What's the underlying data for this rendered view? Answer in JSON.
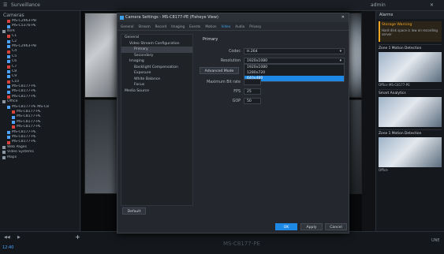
{
  "topbar": {
    "app_menu": "Surveillance",
    "status_right": "admin"
  },
  "tree": {
    "header": "Cameras",
    "items": [
      {
        "label": "MS-C2963-PB",
        "level": 1,
        "kind": "cam"
      },
      {
        "label": "MS-C5376-PE",
        "level": 1,
        "kind": "cam"
      },
      {
        "label": "NVR",
        "level": 0,
        "kind": "folder"
      },
      {
        "label": "C1",
        "level": 1,
        "kind": "cam"
      },
      {
        "label": "C2",
        "level": 1,
        "kind": "cam"
      },
      {
        "label": "MS-C2963-PB",
        "level": 1,
        "kind": "cam"
      },
      {
        "label": "C4",
        "level": 1,
        "kind": "cam"
      },
      {
        "label": "C5",
        "level": 1,
        "kind": "cam"
      },
      {
        "label": "C6",
        "level": 1,
        "kind": "cam"
      },
      {
        "label": "C7",
        "level": 1,
        "kind": "cam"
      },
      {
        "label": "C8",
        "level": 1,
        "kind": "cam"
      },
      {
        "label": "C9",
        "level": 1,
        "kind": "cam"
      },
      {
        "label": "C10",
        "level": 1,
        "kind": "cam"
      },
      {
        "label": "MS-C8177-PE",
        "level": 1,
        "kind": "cam"
      },
      {
        "label": "MS-C8177-PE",
        "level": 1,
        "kind": "cam"
      },
      {
        "label": "MS-C8177-PE",
        "level": 1,
        "kind": "cam"
      },
      {
        "label": "Office",
        "level": 0,
        "kind": "folder"
      },
      {
        "label": "MS-C8177-PE MS-C8",
        "level": 1,
        "kind": "cam"
      },
      {
        "label": "MS-C8177-PE",
        "level": 2,
        "kind": "cam"
      },
      {
        "label": "MS-C8177-PE",
        "level": 2,
        "kind": "cam"
      },
      {
        "label": "MS-C8177-PE",
        "level": 2,
        "kind": "cam"
      },
      {
        "label": "MS-C8177-PE",
        "level": 2,
        "kind": "cam"
      },
      {
        "label": "MS-C8177-PE",
        "level": 1,
        "kind": "cam"
      },
      {
        "label": "MS-C8177-PE",
        "level": 1,
        "kind": "cam"
      },
      {
        "label": "MS-C8177-PE",
        "level": 1,
        "kind": "cam"
      },
      {
        "label": "Web Pages",
        "level": 0,
        "kind": "folder"
      },
      {
        "label": "Video Systems",
        "level": 0,
        "kind": "folder"
      },
      {
        "label": "Maps",
        "level": 0,
        "kind": "folder"
      }
    ]
  },
  "dialog": {
    "title": "Camera Settings - MS-C8177-PE (Fisheye View)",
    "tabs": [
      "General",
      "Stream",
      "Record",
      "Imaging",
      "Events",
      "Motion",
      "Video",
      "Audio",
      "Privacy"
    ],
    "active_tab": 6,
    "nav": [
      {
        "label": "General",
        "level": 0
      },
      {
        "label": "Video Stream Configuration",
        "level": 1
      },
      {
        "label": "Primary",
        "level": 2,
        "sel": true
      },
      {
        "label": "Secondary",
        "level": 2
      },
      {
        "label": "Imaging",
        "level": 1
      },
      {
        "label": "Backlight Compensation",
        "level": 2
      },
      {
        "label": "Exposure",
        "level": 2
      },
      {
        "label": "White Balance",
        "level": 2
      },
      {
        "label": "Focus",
        "level": 2
      },
      {
        "label": "Media Source",
        "level": 0
      }
    ],
    "group_title": "Primary",
    "codec_label": "Codec",
    "codec_value": "H.264",
    "resolution_label": "Resolution",
    "resolution_value": "1920x1080",
    "resolution_options": [
      "1920x1080",
      "1280x720",
      "640x480"
    ],
    "resolution_selected": 2,
    "advanced_button": "Advanced Mode",
    "bitrate_label": "Maximum Bit rate",
    "bitrate_value": "",
    "fps_label": "FPS",
    "fps_value": "25",
    "gop_label": "GOP",
    "gop_value": "50",
    "default_button": "Default",
    "ok_button": "OK",
    "apply_button": "Apply",
    "cancel_button": "Cancel"
  },
  "right": {
    "header": "Alarms",
    "alert_title": "Storage Warning",
    "alert_text": "Hard disk space is low on recording server",
    "events": [
      {
        "title": "Zone 1 Motion Detection",
        "text": "Office MS-C8177-PE"
      },
      {
        "title": "Smart Analytics",
        "text": ""
      },
      {
        "title": "Zone 1 Motion Detection",
        "text": "Office"
      }
    ]
  },
  "bottom": {
    "camera_name": "MS-C8177-PE",
    "time": "12:40",
    "zone": "UNE"
  },
  "colors": {
    "accent": "#1e88e5",
    "alert": "#f5a623"
  }
}
